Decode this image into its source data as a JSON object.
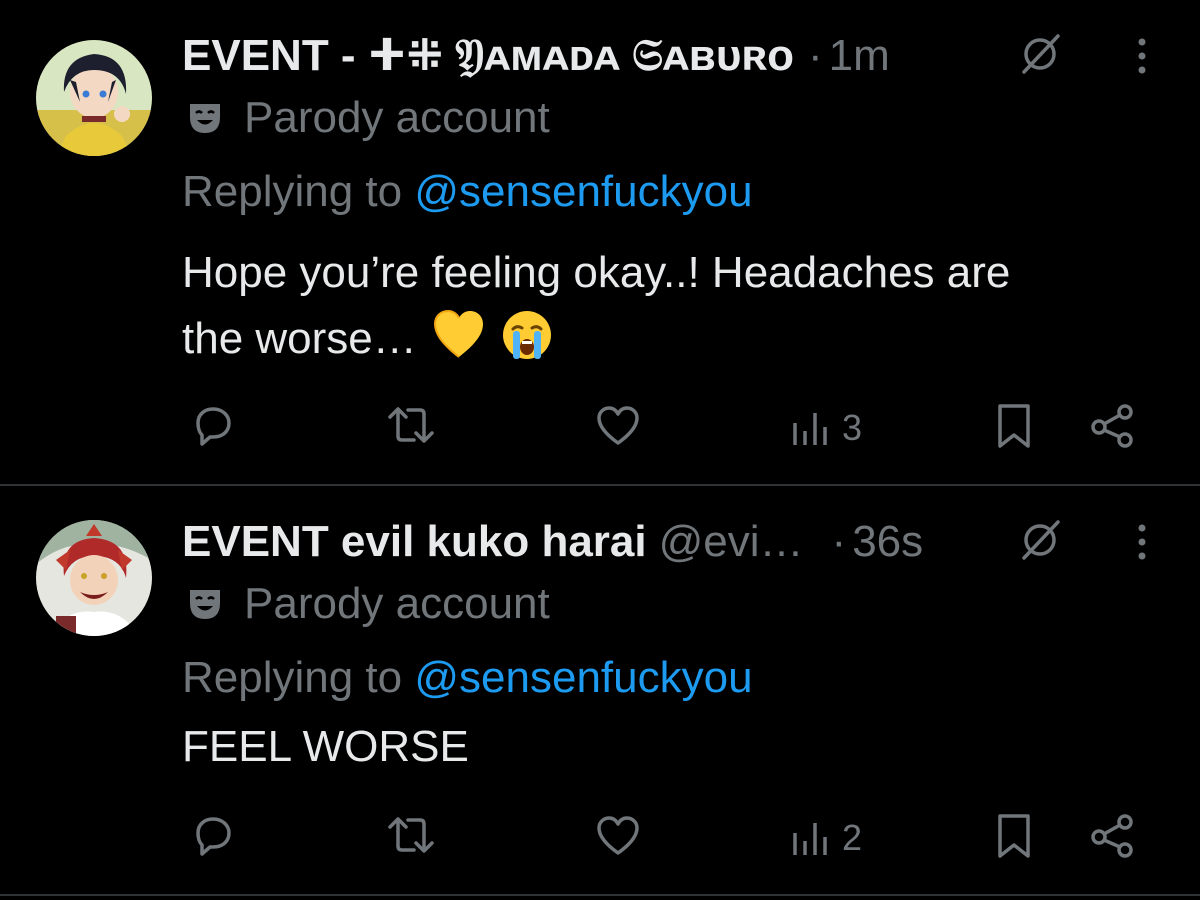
{
  "tweets": [
    {
      "display_name": "EVENT - ⵜ⁜ 𝔜ᴀᴍᴀᴅᴀ 𝔖ᴀʙᴜʀᴏ",
      "handle": "",
      "dot": "·",
      "time": "1m",
      "parody_label": "Parody account",
      "replying_prefix": "Replying to ",
      "replying_to": "@sensenfuckyou",
      "text_line1": "Hope you’re feeling okay..! Headaches are",
      "text_line2": "the worse…",
      "emojis": [
        "yellow-heart",
        "loudly-crying-face"
      ],
      "views": "3"
    },
    {
      "display_name": "EVENT evil kuko harai",
      "handle": "@evi…",
      "dot": "·",
      "time": "36s",
      "parody_label": "Parody account",
      "replying_prefix": "Replying to ",
      "replying_to": "@sensenfuckyou",
      "text_line1": "FEEL WORSE",
      "text_line2": "",
      "emojis": [],
      "views": "2"
    }
  ],
  "icons": {
    "reply": "reply-icon",
    "retweet": "retweet-icon",
    "like": "heart-icon",
    "views": "views-icon",
    "bookmark": "bookmark-icon",
    "share": "share-icon",
    "grok": "grok-icon",
    "more": "more-icon",
    "parody": "mask-icon"
  },
  "colors": {
    "background": "#000000",
    "text_primary": "#e7e9ea",
    "text_secondary": "#71767b",
    "link": "#1d9bf0",
    "divider": "#2f3336"
  }
}
